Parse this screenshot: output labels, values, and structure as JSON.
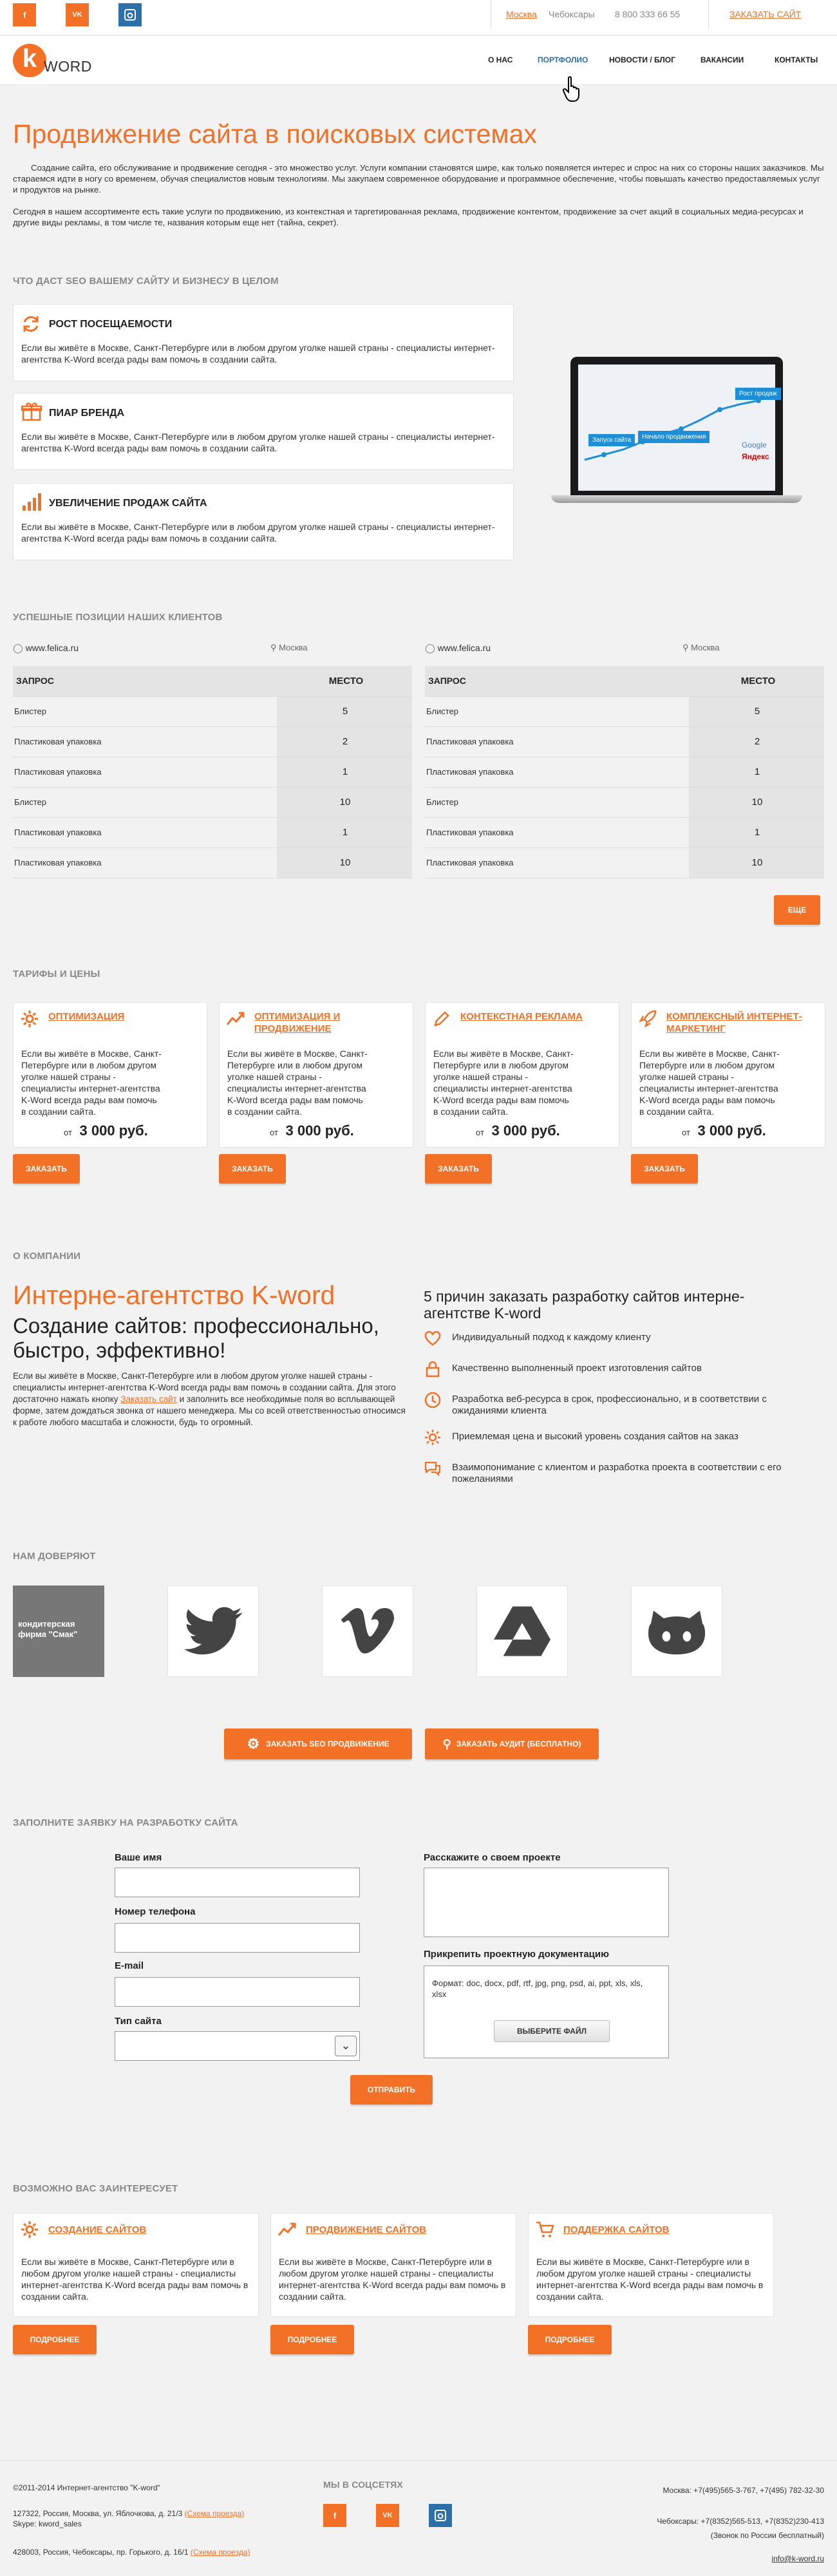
{
  "top": {
    "social": [
      "f",
      "VK",
      "in"
    ],
    "city_active": "Москва",
    "city_other": "Чебоксары",
    "phone": "8 800 333 66 55",
    "order_link": "ЗАКАЗАТЬ САЙТ"
  },
  "logo": {
    "letter": "k",
    "word": "WORD"
  },
  "nav": [
    "О НАС",
    "ПОРТФОЛИО",
    "НОВОСТИ / БЛОГ",
    "ВАКАНСИИ",
    "КОНТАКТЫ"
  ],
  "intro": {
    "title": "Продвижение сайта в поисковых системах",
    "p1": "Создание сайта, его обслуживание и продвижение сегодня - это множество услуг. Услуги компании становятся шире, как только появляется интерес и спрос на них со стороны наших заказчиков. Мы стараемся идти в ногу со временем, обучая специалистов новым технологиям. Мы закупаем современное оборудование и программное обеспечение, чтобы повышать качество предоставляемых услуг и продуктов на рынке.",
    "p2": "Сегодня в нашем ассортименте есть такие услуги по продвижению, из контекстная и таргетированная реклама, продвижение контентом, продвижение за счет акций в социальных медиа-ресурсах и другие виды рекламы, в том числе те, названия которым еще нет (тайна, секрет)."
  },
  "seo": {
    "title": "ЧТО ДАСТ SEO ВАШЕМУ САЙТУ И БИЗНЕСУ В ЦЕЛОМ",
    "cards": [
      {
        "title": "РОСТ ПОСЕЩАЕМОСТИ",
        "text": "Если вы живёте в Москве, Санкт-Петербурге или в любом другом уголке нашей страны - специалисты интернет-агентства K-Word всегда рады вам помочь в создании сайта.",
        "icon": "refresh-icon"
      },
      {
        "title": "ПИАР БРЕНДА",
        "text": "Если вы живёте в Москве, Санкт-Петербурге или в любом другом уголке нашей страны - специалисты интернет-агентства K-Word всегда рады вам помочь в создании сайта.",
        "icon": "gift-icon"
      },
      {
        "title": "УВЕЛИЧЕНИЕ ПРОДАЖ САЙТА",
        "text": "Если вы живёте в Москве, Санкт-Петербурге или в любом другом уголке нашей страны - специалисты интернет-агентства K-Word всегда рады вам помочь в создании сайта.",
        "icon": "bar-chart-icon"
      }
    ],
    "laptop": {
      "tag1": "Запуск сайта",
      "tag2": "Начало продвижения",
      "tag3": "Рост продаж",
      "brand1": "Google",
      "brand2": "Яндекс"
    }
  },
  "positions": {
    "title": "УСПЕШНЫЕ ПОЗИЦИИ НАШИХ КЛИЕНТОВ",
    "tables": [
      {
        "site": "www.felica.ru",
        "city": "Москва",
        "col1": "ЗАПРОС",
        "col2": "МЕСТО",
        "rows": [
          [
            "Блистер",
            "5"
          ],
          [
            "Пластиковая упаковка",
            "2"
          ],
          [
            "Пластиковая упаковка",
            "1"
          ],
          [
            "Блистер",
            "10"
          ],
          [
            "Пластиковая упаковка",
            "1"
          ],
          [
            "Пластиковая упаковка",
            "10"
          ]
        ]
      },
      {
        "site": "www.felica.ru",
        "city": "Москва",
        "col1": "ЗАПРОС",
        "col2": "МЕСТО",
        "rows": [
          [
            "Блистер",
            "5"
          ],
          [
            "Пластиковая упаковка",
            "2"
          ],
          [
            "Пластиковая упаковка",
            "1"
          ],
          [
            "Блистер",
            "10"
          ],
          [
            "Пластиковая упаковка",
            "1"
          ],
          [
            "Пластиковая упаковка",
            "10"
          ]
        ]
      }
    ],
    "more": "ЕЩЕ"
  },
  "tariffs": {
    "title": "ТАРИФЫ И ЦЕНЫ",
    "items": [
      {
        "title": "ОПТИМИЗАЦИЯ",
        "text": "Если вы живёте в Москве, Санкт-Петербурге или в любом другом уголке нашей страны - специалисты интернет-агентства K-Word всегда рады вам помочь в создании сайта.",
        "from": "от",
        "price": "3 000 руб.",
        "button": "ЗАКАЗАТЬ",
        "icon": "gear-icon"
      },
      {
        "title": "ОПТИМИЗАЦИЯ И ПРОДВИЖЕНИЕ",
        "text": "Если вы живёте в Москве, Санкт-Петербурге или в любом другом уголке нашей страны - специалисты интернет-агентства K-Word всегда рады вам помочь в создании сайта.",
        "from": "от",
        "price": "3 000 руб.",
        "button": "ЗАКАЗАТЬ",
        "icon": "trend-icon"
      },
      {
        "title": "КОНТЕКСТНАЯ РЕКЛАМА",
        "text": "Если вы живёте в Москве, Санкт-Петербурге или в любом другом уголке нашей страны - специалисты интернет-агентства K-Word всегда рады вам помочь в создании сайта.",
        "from": "от",
        "price": "3 000 руб.",
        "button": "ЗАКАЗАТЬ",
        "icon": "pencil-icon"
      },
      {
        "title": "КОМПЛЕКСНЫЙ ИНТЕРНЕТ-МАРКЕТИНГ",
        "text": "Если вы живёте в Москве, Санкт-Петербурге или в любом другом уголке нашей страны - специалисты интернет-агентства K-Word всегда рады вам помочь в создании сайта.",
        "from": "от",
        "price": "3 000 руб.",
        "button": "ЗАКАЗАТЬ",
        "icon": "rocket-icon"
      }
    ]
  },
  "about": {
    "title": "О КОМПАНИИ",
    "h1": "Интерне-агентство K-word",
    "h2": "Создание сайтов: профессионально, быстро, эффективно!",
    "p_before": "Если вы живёте в Москве, Санкт-Петербурге или в любом другом уголке нашей страны - специалисты интернет-агентства K-Word всегда рады вам помочь в создании сайта. Для этого достаточно нажать кнопку",
    "p_link": "Заказать сайт",
    "p_after": "и заполнить все необходимые поля во всплывающей форме, затем дождаться звонка от нашего менеджера. Мы со всей ответственностью относимся к работе любого масштаба и сложности, будь то огромный.",
    "reasons_title": "5 причин заказать разработку сайтов интерне-агентстве K-word",
    "reasons": [
      "Индивидуальный подход к каждому клиенту",
      "Качественно выполненный проект изготовления сайтов",
      "Разработка веб-ресурса в срок, профессионально, и в соответствии с ожиданиями клиента",
      "Приемлемая цена и высокий уровень создания сайтов на заказ",
      "Взаимопонимание с клиентом и разработка проекта в соответствии с его пожеланиями"
    ]
  },
  "trust": {
    "title": "НАМ ДОВЕРЯЮТ",
    "first_label": "кондитерская фирма \"Смак\"",
    "logos": [
      "twitter-icon",
      "vimeo-icon",
      "drive-icon",
      "github-icon"
    ]
  },
  "cta": {
    "seo": "ЗАКАЗАТЬ SEO ПРОДВИЖЕНИЕ",
    "audit": "ЗАКАЗАТЬ АУДИТ (бесплатно)"
  },
  "form": {
    "title": "ЗАПОЛНИТЕ ЗАЯВКУ НА РАЗРАБОТКУ САЙТА",
    "name": "Ваше имя",
    "phone": "Номер телефона",
    "email": "E-mail",
    "type": "Тип сайта",
    "about": "Расскажите о своем проекте",
    "attach": "Прикрепить проектную документацию",
    "formats": "Формат: doc, docx, pdf, rtf, jpg, png, psd, ai, ppt, xls, xls, xlsx",
    "choose": "ВЫБЕРИТЕ ФАЙЛ",
    "submit": "ОТПРАВИТЬ"
  },
  "interest": {
    "title": "ВОЗМОЖНО ВАС ЗАИНТЕРЕСУЕТ",
    "items": [
      {
        "title": "СОЗДАНИЕ САЙТОВ",
        "text": "Если вы живёте в Москве, Санкт-Петербурге или в любом другом уголке нашей страны - специалисты интернет-агентства K-Word всегда рады вам помочь в создании сайта.",
        "button": "ПОДРОБНЕЕ",
        "icon": "gear-icon"
      },
      {
        "title": "ПРОДВИЖЕНИЕ САЙТОВ",
        "text": "Если вы живёте в Москве, Санкт-Петербурге или в любом другом уголке нашей страны - специалисты интернет-агентства K-Word всегда рады вам помочь в создании сайта.",
        "button": "ПОДРОБНЕЕ",
        "icon": "trend-icon"
      },
      {
        "title": "ПОДДЕРЖКА САЙТОВ",
        "text": "Если вы живёте в Москве, Санкт-Петербурге или в любом другом уголке нашей страны - специалисты интернет-агентства K-Word всегда рады вам помочь в создании сайта.",
        "button": "ПОДРОБНЕЕ",
        "icon": "cart-icon"
      }
    ]
  },
  "footer": {
    "copyright": "©2011-2014 Интернет-агентство \"K-word\"",
    "addr1": "127322, Россия, Москва, ул. Яблочкова, д. 21/3",
    "scheme": "(Схема проезда)",
    "skype": "Skype: kword_sales",
    "addr2": "428003, Россия, Чебоксары, пр. Горького, д. 16/1",
    "social_title": "МЫ В СОЦСЕТЯХ",
    "social": [
      "f",
      "VK",
      "in"
    ],
    "phone_msk": "Москва: +7(495)565-3-767, +7(495) 782-32-30",
    "phone_cheb": "Чебоксары: +7(8352)565-513, +7(8352)230-413",
    "free_call": "(Звонок по России бесплатный)",
    "email": "info@k-word.ru"
  },
  "colors": {
    "accent": "#f27127",
    "fb": "#f27127",
    "vk": "#f27127",
    "in": "#2d6fa8"
  }
}
